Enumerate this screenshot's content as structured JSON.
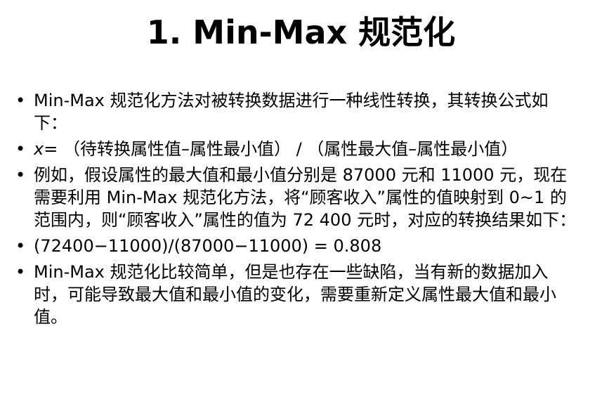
{
  "title": "1. Min-Max 规范化",
  "bullet_symbol": "•",
  "bullets": [
    {
      "text": "Min-Max 规范化方法对被转换数据进行一种线性转换，其转换公式如下："
    },
    {
      "var": "x",
      "text": "= （待转换属性值–属性最小值） / （属性最大值–属性最小值）"
    },
    {
      "text": "例如，假设属性的最大值和最小值分别是 87000 元和 11000 元，现在需要利用 Min-Max 规范化方法，将“顾客收入”属性的值映射到 0~1  的范围内，则“顾客收入”属性的值为 72 400 元时，对应的转换结果如下："
    },
    {
      "text": "(72400−11000)/(87000−11000) = 0.808"
    },
    {
      "text": "  Min-Max 规范化比较简单，但是也存在一些缺陷，当有新的数据加入时，可能导致最大值和最小值的变化，需要重新定义属性最大值和最小值。"
    }
  ]
}
